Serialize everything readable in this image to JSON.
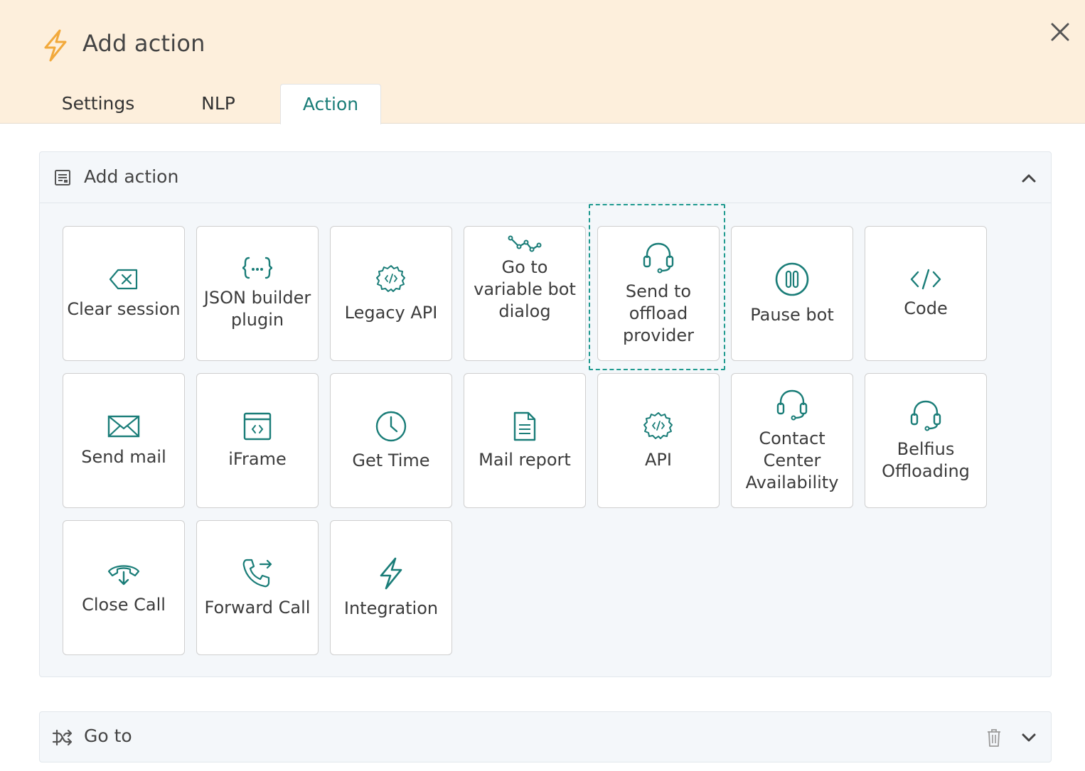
{
  "dialog": {
    "title": "Add action",
    "title_icon": "lightning-icon",
    "close_icon": "close-icon"
  },
  "tabs": [
    {
      "label": "Settings",
      "active": false
    },
    {
      "label": "NLP",
      "active": false
    },
    {
      "label": "Action",
      "active": true
    }
  ],
  "add_action_panel": {
    "title": "Add action",
    "icon": "form-icon",
    "collapse_icon": "chevron-up-icon",
    "actions": [
      {
        "label": "Clear session",
        "icon": "backspace-icon"
      },
      {
        "label": "JSON builder plugin",
        "icon": "json-braces-icon"
      },
      {
        "label": "Legacy API",
        "icon": "api-gear-icon"
      },
      {
        "label": "Go to variable bot dialog",
        "icon": "path-nodes-icon"
      },
      {
        "label": "Send to offload provider",
        "icon": "headset-icon",
        "highlighted": true
      },
      {
        "label": "Pause bot",
        "icon": "pause-icon"
      },
      {
        "label": "Code",
        "icon": "code-icon"
      },
      {
        "label": "Send mail",
        "icon": "mail-icon"
      },
      {
        "label": "iFrame",
        "icon": "iframe-icon"
      },
      {
        "label": "Get Time",
        "icon": "clock-icon"
      },
      {
        "label": "Mail report",
        "icon": "document-icon"
      },
      {
        "label": "API",
        "icon": "api-gear-icon"
      },
      {
        "label": "Contact Center Availability",
        "icon": "headset-icon"
      },
      {
        "label": "Belfius Offloading",
        "icon": "headset-icon"
      },
      {
        "label": "Close Call",
        "icon": "hangup-phone-icon"
      },
      {
        "label": "Forward Call",
        "icon": "forward-call-icon"
      },
      {
        "label": "Integration",
        "icon": "lightning-icon"
      }
    ]
  },
  "goto_panel": {
    "title": "Go to",
    "icon": "shuffle-icon",
    "delete_icon": "trash-icon",
    "expand_icon": "chevron-down-icon"
  },
  "colors": {
    "header_bg": "#fdefdc",
    "accent": "#1a7d78",
    "title_icon": "#f2a93b",
    "panel_bg": "#f4f7fa",
    "highlight_border": "#1f9a8f"
  }
}
